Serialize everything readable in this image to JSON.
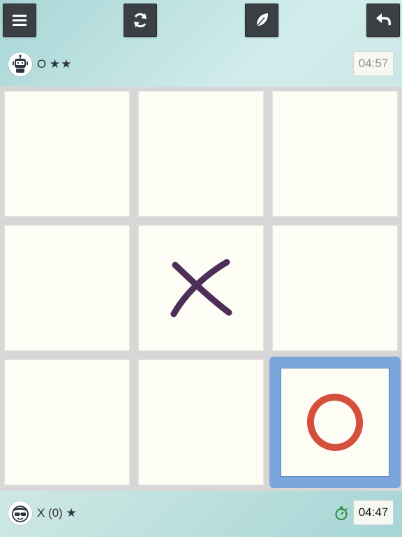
{
  "toolbar": {
    "buttons": [
      {
        "name": "menu-button",
        "icon": "hamburger-icon"
      },
      {
        "name": "restart-button",
        "icon": "refresh-icon"
      },
      {
        "name": "theme-button",
        "icon": "feather-icon"
      },
      {
        "name": "undo-button",
        "icon": "undo-arrow-icon"
      }
    ]
  },
  "top_player": {
    "avatar": "robot-icon",
    "symbol": "O",
    "stars": "★★",
    "timer": "04:57",
    "active": false
  },
  "bottom_player": {
    "avatar": "human-glasses-icon",
    "label": "X (0)",
    "stars": "★",
    "timer": "04:47",
    "active": true
  },
  "board": {
    "cells": [
      "",
      "",
      "",
      "",
      "X",
      "",
      "",
      "",
      "O"
    ],
    "last_move_index": 8
  },
  "colors": {
    "x_mark": "#4d2e57",
    "o_mark": "#d4503a",
    "highlight": "#7aa6dc",
    "stopwatch": "#2e8b3a"
  }
}
